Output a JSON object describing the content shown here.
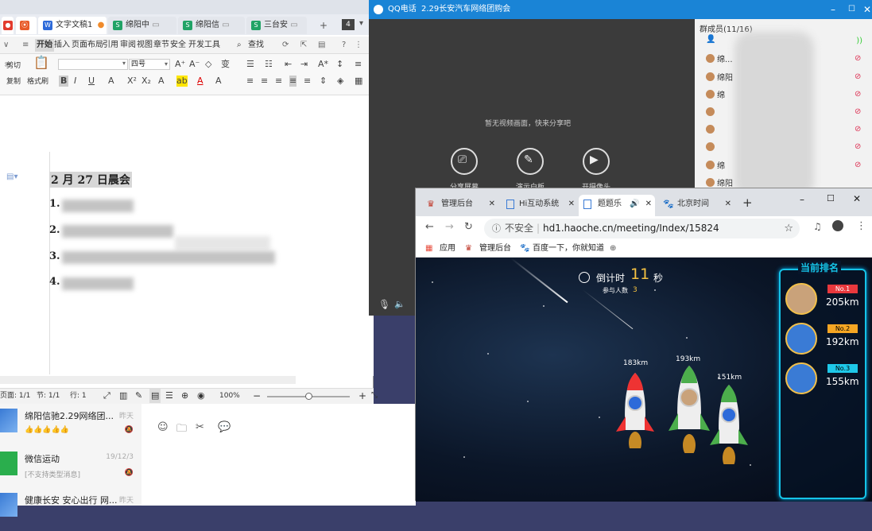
{
  "wps": {
    "tabs": [
      {
        "label": ""
      },
      {
        "label": "文字文稿1"
      },
      {
        "label": "绵阳中"
      },
      {
        "label": "绵阳信"
      },
      {
        "label": "三台安"
      }
    ],
    "tab_count": "4",
    "ribbon_tabs": [
      "开始",
      "插入",
      "页面布局",
      "引用",
      "审阅",
      "视图",
      "章节",
      "安全",
      "开发工具"
    ],
    "search_label": "查找",
    "ribbon": {
      "cut": "剪切",
      "paste": "粘贴",
      "copy": "复制",
      "format_painter": "格式刷",
      "font_size": "四号"
    },
    "doc": {
      "title": "2 月 27 日晨会",
      "items": [
        "1.",
        "2.",
        "3.",
        "4."
      ]
    },
    "status": {
      "pages": "页面: 1/1",
      "section": "节: 1/1",
      "row": "行: 1",
      "zoom": "100%"
    }
  },
  "chats": [
    {
      "name": "绵阳信驰2.29网络团...",
      "time": "昨天",
      "sub": "👍👍👍👍👍"
    },
    {
      "name": "微信运动",
      "time": "19/12/3",
      "sub": "[不支持类型消息]"
    },
    {
      "name": "健康长安 安心出行 网...",
      "time": "昨天",
      "sub": ""
    }
  ],
  "qq": {
    "app_label": "QQ电话",
    "window_title": "2.29长安汽车网络团购会",
    "no_video": "暂无视频画面，快来分享吧",
    "buttons": [
      "分享屏幕",
      "演示白板",
      "开摄像头"
    ],
    "members_header": "群成员(11/16)",
    "members": [
      "",
      "绵...",
      "绵阳",
      "绵",
      "",
      "",
      "",
      "绵",
      "绵阳"
    ]
  },
  "browser": {
    "tabs": [
      {
        "label": "管理后台"
      },
      {
        "label": "Hi互动系统"
      },
      {
        "label": "题题乐"
      },
      {
        "label": "北京时间"
      }
    ],
    "url_prefix": "不安全",
    "url": "hd1.haoche.cn/meeting/Index/15824",
    "bookmarks": [
      "应用",
      "管理后台",
      "百度一下，你就知道"
    ]
  },
  "game": {
    "countdown_label": "倒计时",
    "countdown_value": "11",
    "countdown_unit": "秒",
    "participants_label": "参与人数",
    "participants_value": "3",
    "rank_title": "当前排名",
    "ranking": [
      {
        "badge": "No.1",
        "distance": "205km",
        "color": "#e8383d"
      },
      {
        "badge": "No.2",
        "distance": "192km",
        "color": "#f5a623"
      },
      {
        "badge": "No.3",
        "distance": "155km",
        "color": "#1ec8e8"
      }
    ],
    "rockets": [
      {
        "distance": "183km"
      },
      {
        "distance": "193km"
      },
      {
        "distance": "151km"
      }
    ]
  }
}
